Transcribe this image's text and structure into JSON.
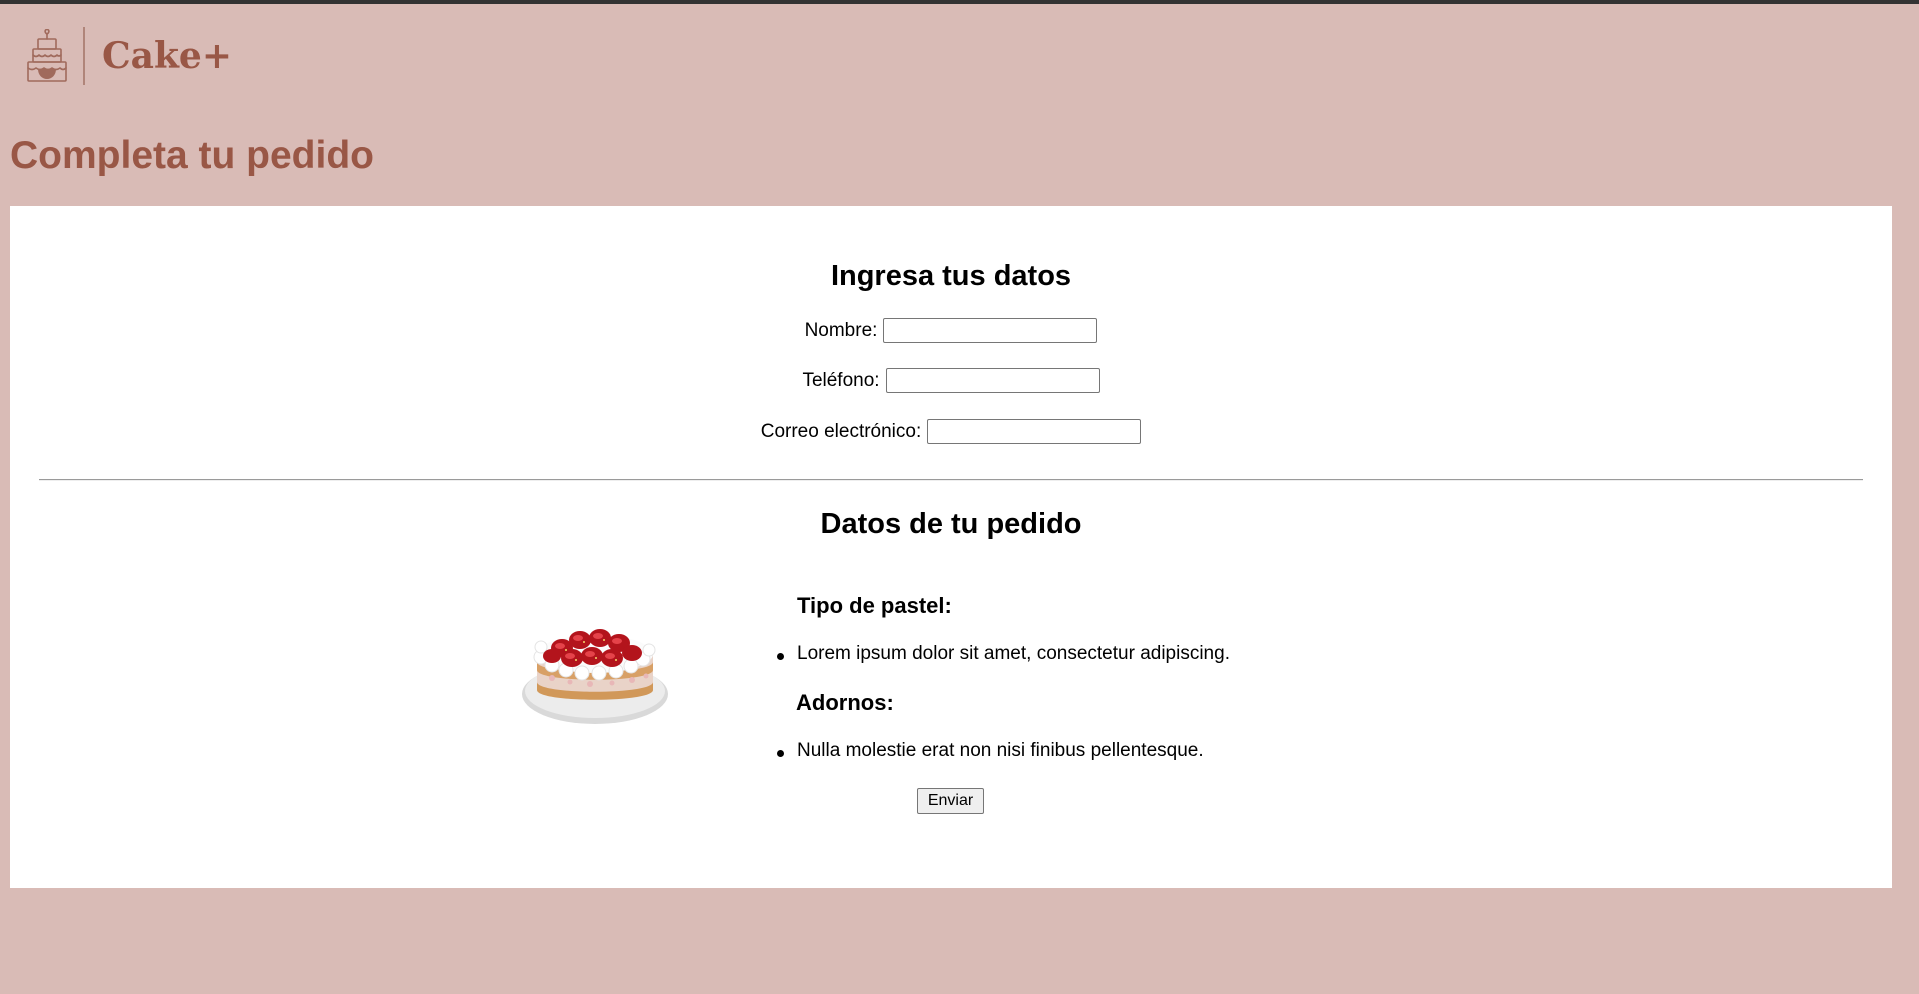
{
  "brand": {
    "name": "Cake+",
    "icon": "cake-icon",
    "color": "#995746"
  },
  "page": {
    "title": "Completa tu pedido",
    "background": "#d9bbb6"
  },
  "customer_section": {
    "title": "Ingresa tus datos",
    "fields": [
      {
        "label": "Nombre:",
        "value": "",
        "placeholder": ""
      },
      {
        "label": "Teléfono:",
        "value": "",
        "placeholder": ""
      },
      {
        "label": "Correo electrónico:",
        "value": "",
        "placeholder": ""
      }
    ]
  },
  "order_section": {
    "title": "Datos de tu pedido",
    "image": "strawberry-cake-image",
    "cake_type": {
      "heading": "Tipo de pastel:",
      "items": [
        "Lorem ipsum dolor sit amet, consectetur adipiscing."
      ]
    },
    "decorations": {
      "heading": "Adornos:",
      "items": [
        "Nulla molestie erat non nisi finibus pellentesque."
      ]
    },
    "submit_label": "Enviar"
  }
}
